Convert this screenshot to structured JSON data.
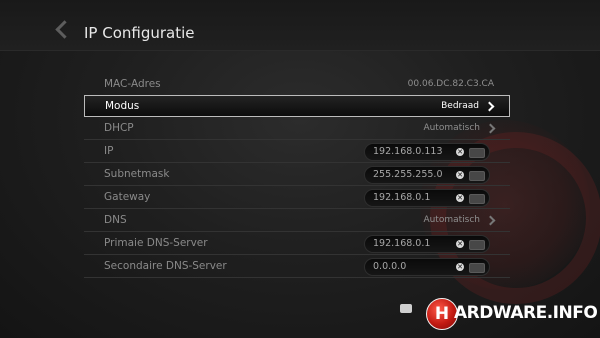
{
  "header": {
    "title": "IP Configuratie"
  },
  "rows": [
    {
      "label": "MAC-Adres",
      "value": "00.06.DC.82.C3.CA"
    },
    {
      "label": "Modus",
      "value": "Bedraad"
    },
    {
      "label": "DHCP",
      "value": "Automatisch"
    },
    {
      "label": "IP",
      "value": "192.168.0.113"
    },
    {
      "label": "Subnetmask",
      "value": "255.255.255.0"
    },
    {
      "label": "Gateway",
      "value": "192.168.0.1"
    },
    {
      "label": "DNS",
      "value": "Automatisch"
    },
    {
      "label": "Primaie DNS-Server",
      "value": "192.168.0.1"
    },
    {
      "label": "Secondaire DNS-Server",
      "value": "0.0.0.0"
    }
  ],
  "watermark": {
    "logo_letter": "H",
    "logo_text": "ARDWARE.INFO",
    "accent": "#c21a12"
  },
  "icons": {
    "clear": "clear-icon",
    "keyboard": "keyboard-icon",
    "back": "back-arrow-icon",
    "chevron": "chevron-right-icon"
  }
}
